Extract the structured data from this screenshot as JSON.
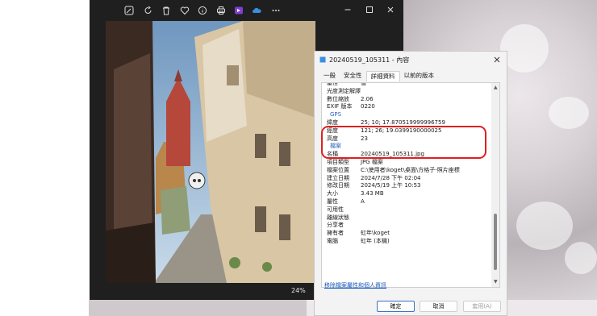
{
  "photos": {
    "toolbar_icons": [
      "edit-icon",
      "rotate-icon",
      "delete-icon",
      "favorite-icon",
      "info-icon",
      "print-icon",
      "clipchamp-icon",
      "onedrive-icon",
      "more-icon"
    ],
    "window_controls": [
      "minimize-icon",
      "maximize-icon",
      "close-icon"
    ],
    "zoom": "24%"
  },
  "dialog": {
    "title": "20240519_105311 - 內容",
    "tabs": [
      {
        "label": "一般"
      },
      {
        "label": "安全性"
      },
      {
        "label": "詳細資料"
      },
      {
        "label": "以前的版本"
      }
    ],
    "header": {
      "key": "屬性",
      "value": "值"
    },
    "rows": [
      {
        "key": "光度測定解譯",
        "value": ""
      },
      {
        "key": "數位縮放",
        "value": "2.06"
      },
      {
        "key": "EXIF 版本",
        "value": "0220"
      },
      {
        "key": "GPS",
        "value": ""
      },
      {
        "key": "緯度",
        "value": "25; 10; 17.870519999996759"
      },
      {
        "key": "經度",
        "value": "121; 26; 19.0399190000025"
      },
      {
        "key": "高度",
        "value": "23"
      },
      {
        "key": "檔案",
        "value": ""
      },
      {
        "key": "名稱",
        "value": "20240519_105311.jpg"
      },
      {
        "key": "項目類型",
        "value": "JPG 檔案"
      },
      {
        "key": "檔案位置",
        "value": "C:\\使用者\\koget\\桌面\\方格子-照片座標"
      },
      {
        "key": "建立日期",
        "value": "2024/7/28 下午 02:04"
      },
      {
        "key": "修改日期",
        "value": "2024/5/19 上午 10:53"
      },
      {
        "key": "大小",
        "value": "3.43 MB"
      },
      {
        "key": "屬性",
        "value": "A"
      },
      {
        "key": "可用性",
        "value": ""
      },
      {
        "key": "離線狀態",
        "value": ""
      },
      {
        "key": "分享者",
        "value": ""
      },
      {
        "key": "擁有者",
        "value": "虹年\\koget"
      },
      {
        "key": "電腦",
        "value": "虹年 (本機)"
      }
    ],
    "remove_link": "移除檔案屬性和個人資訊",
    "buttons": {
      "ok": "確定",
      "cancel": "取消",
      "apply": "套用(A)"
    }
  }
}
